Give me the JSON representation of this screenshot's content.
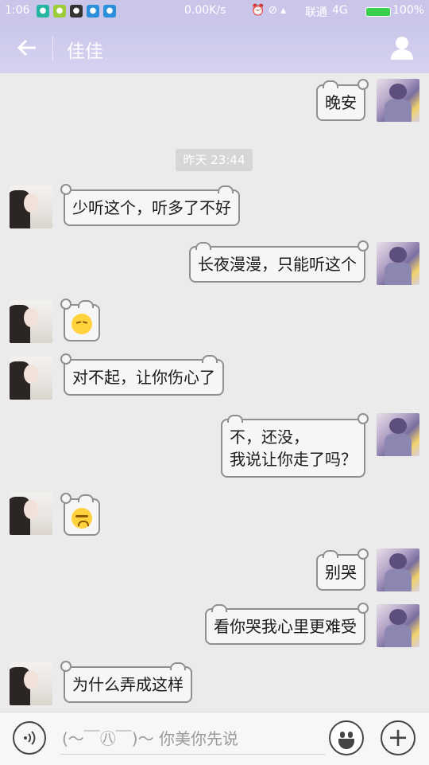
{
  "status_bar": {
    "time": "1:06",
    "net_speed": "0.00K/s",
    "carrier": "联通",
    "network": "4G",
    "battery": "100%",
    "battery_level": 1.0
  },
  "header": {
    "back_icon": "back-arrow-icon",
    "title": "佳佳",
    "profile_icon": "person-icon"
  },
  "chat": {
    "timestamp": "昨天 23:44",
    "messages": [
      {
        "side": "right",
        "text": "晚安"
      },
      {
        "side": "left",
        "text": "少听这个，听多了不好"
      },
      {
        "side": "right",
        "text": "长夜漫漫，只能听这个"
      },
      {
        "side": "left",
        "emoji": "pensive-face"
      },
      {
        "side": "left",
        "text": "对不起，让你伤心了"
      },
      {
        "side": "right",
        "line1": "不，还没，",
        "line2": "我说让你走了吗？"
      },
      {
        "side": "left",
        "emoji": "crying-face"
      },
      {
        "side": "right",
        "text": "别哭"
      },
      {
        "side": "right",
        "text": "看你哭我心里更难受"
      },
      {
        "side": "left",
        "text": "为什么弄成这样"
      }
    ]
  },
  "input_bar": {
    "placeholder": "(〜￣㊇￣)〜 你美你先说",
    "voice_icon": "voice-icon",
    "emoji_icon": "smiley-icon",
    "plus_icon": "plus-icon"
  }
}
